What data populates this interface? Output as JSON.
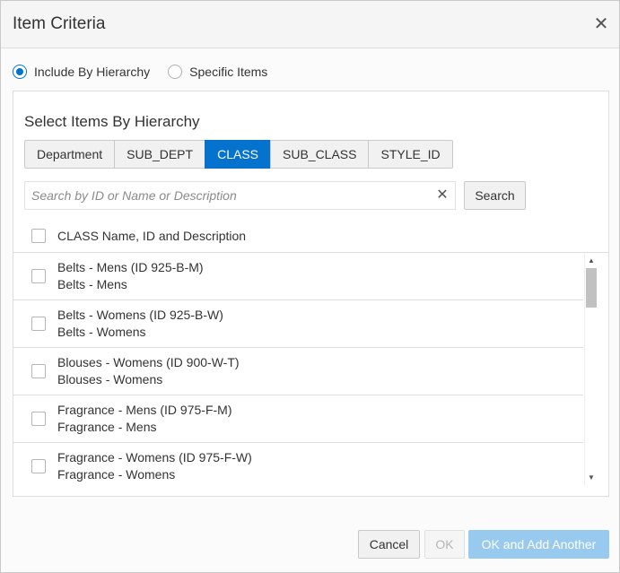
{
  "dialog": {
    "title": "Item Criteria",
    "close_icon": "close-icon"
  },
  "mode": {
    "options": [
      {
        "label": "Include By Hierarchy",
        "selected": true
      },
      {
        "label": "Specific Items",
        "selected": false
      }
    ]
  },
  "hierarchy": {
    "title": "Select Items By Hierarchy",
    "tabs": [
      {
        "label": "Department",
        "active": false
      },
      {
        "label": "SUB_DEPT",
        "active": false
      },
      {
        "label": "CLASS",
        "active": true
      },
      {
        "label": "SUB_CLASS",
        "active": false
      },
      {
        "label": "STYLE_ID",
        "active": false
      }
    ],
    "search": {
      "value": "",
      "placeholder": "Search by ID or Name or Description",
      "clear_icon": "clear-icon",
      "button_label": "Search"
    },
    "list": {
      "header_label": "CLASS Name, ID and Description",
      "rows": [
        {
          "title": "Belts - Mens (ID 925-B-M)",
          "description": "Belts - Mens"
        },
        {
          "title": "Belts - Womens (ID 925-B-W)",
          "description": "Belts - Womens"
        },
        {
          "title": "Blouses - Womens (ID 900-W-T)",
          "description": "Blouses - Womens"
        },
        {
          "title": "Fragrance - Mens (ID 975-F-M)",
          "description": "Fragrance - Mens"
        },
        {
          "title": "Fragrance - Womens (ID 975-F-W)",
          "description": "Fragrance - Womens"
        }
      ]
    }
  },
  "footer": {
    "cancel_label": "Cancel",
    "ok_label": "OK",
    "ok_add_label": "OK and Add Another"
  },
  "colors": {
    "accent": "#0572ce",
    "disabled_primary": "#98c9ee"
  }
}
